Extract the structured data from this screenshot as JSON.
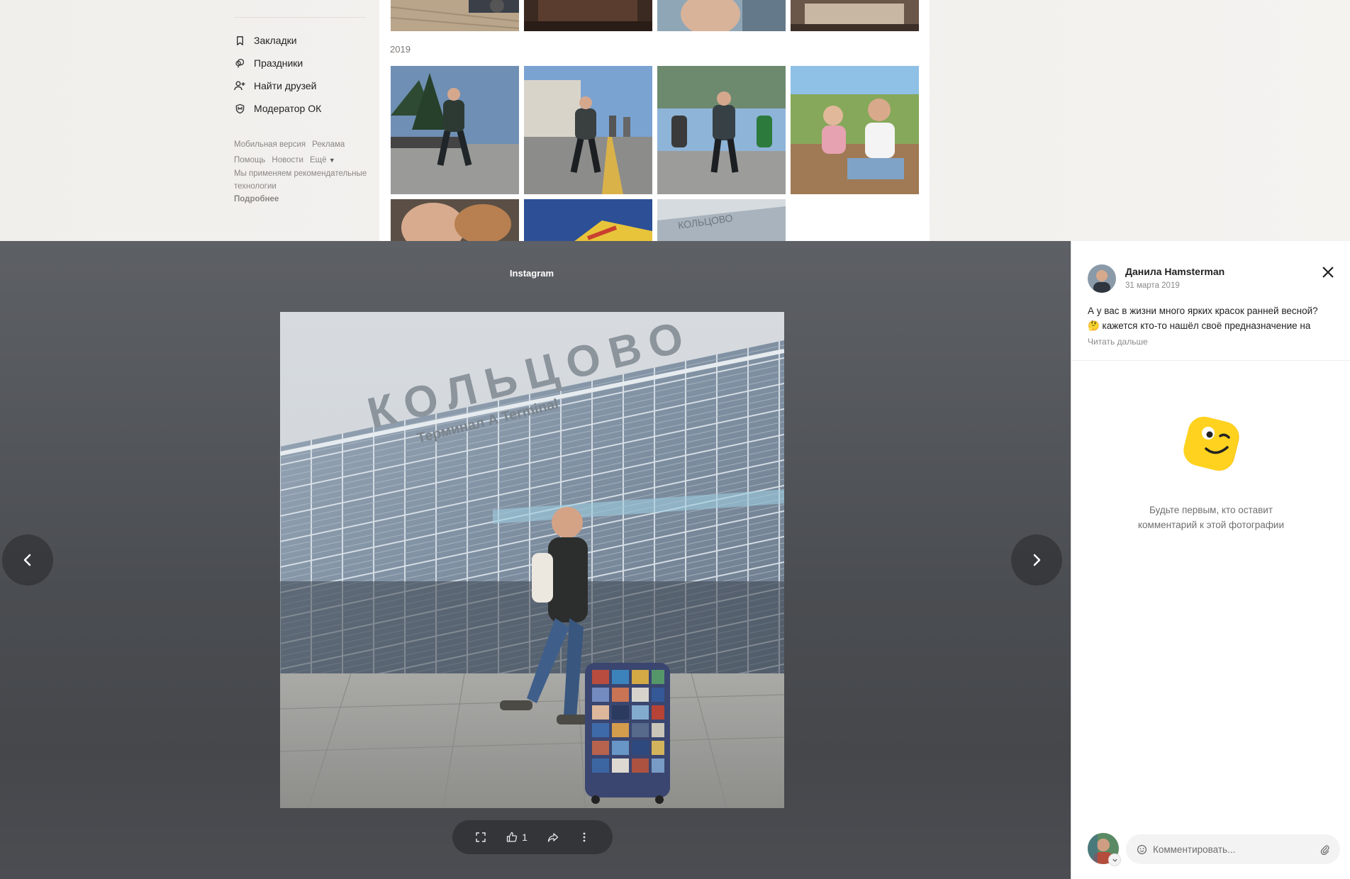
{
  "nav": {
    "items": [
      {
        "label": "Закладки",
        "icon": "bookmark-icon"
      },
      {
        "label": "Праздники",
        "icon": "balloons-icon"
      },
      {
        "label": "Найти друзей",
        "icon": "add-friend-icon"
      },
      {
        "label": "Модератор ОК",
        "icon": "moderator-shield-icon"
      }
    ]
  },
  "footer": {
    "mobile": "Мобильная версия",
    "ads": "Реклама",
    "help": "Помощь",
    "news": "Новости",
    "more": "Ещё",
    "note": "Мы применяем рекомендательные технологии",
    "details": "Подробнее"
  },
  "album": {
    "year": "2019"
  },
  "viewer": {
    "title": "Instagram",
    "likes": "1",
    "photo_sign": "КОЛЬЦОВО",
    "photo_subsign": "Терминал А Terminal"
  },
  "post": {
    "author": "Данила Hamsterman",
    "date": "31 марта 2019",
    "text_line1": "А у вас в жизни много ярких красок ранней весной?",
    "text_line2": "🤔 кажется кто-то нашёл своё предназначение на",
    "read_more": "Читать дальше"
  },
  "comments": {
    "empty_line1": "Будьте первым, кто оставит",
    "empty_line2": "комментарий к этой фотографии",
    "placeholder": "Комментировать..."
  },
  "colors": {
    "accent": "#ee8208",
    "viewer_bg": "#505357",
    "panel_bg": "#ffffff"
  }
}
